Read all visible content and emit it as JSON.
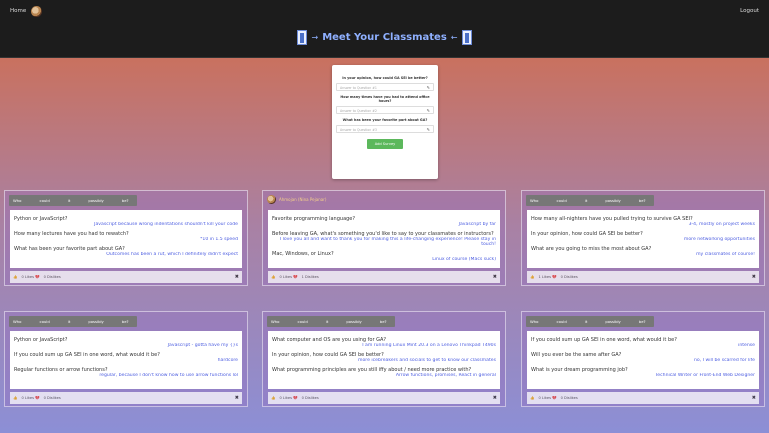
{
  "nav": {
    "home": "Home",
    "logout": "Logout"
  },
  "brand": {
    "title": "Meet Your Classmates"
  },
  "survey": {
    "q1": "In your opinion, how could GA SEI be better?",
    "q1_placeholder": "Answer to Question #1",
    "q2": "How many times have you had to attend office hours?",
    "q2_placeholder": "Answer to Question #2",
    "q3": "What has been your favorite part about GA?",
    "q3_placeholder": "Answer to Question #3",
    "submit": "Add Survey"
  },
  "tabs": [
    "Who",
    "could",
    "it",
    "possibly",
    "be?"
  ],
  "cards": [
    {
      "qa": [
        {
          "q": "Python or JavaScript?",
          "a": "Javascript because wrong indentations shouldn't kill your code"
        },
        {
          "q": "How many lectures have you had to rewatch?",
          "a": "*10 in 1.5 speed"
        },
        {
          "q": "What has been your favorite part about GA?",
          "a": "Outcomes has been a rut, which I definitely didn't expect"
        }
      ],
      "likes": "0 Likes",
      "dislikes": "0 Dislikes"
    },
    {
      "user": "Ahmojan (Nina Pejanar)",
      "qa": [
        {
          "q": "Favorite programming language?",
          "a": "Javascript by far"
        },
        {
          "q": "Before leaving GA, what's something you'd like to say to your classmates or instructors?",
          "a": "I love you all and want to thank you for making this a life-changing experience! Please stay in touch!"
        },
        {
          "q": "Mac, Windows, or Linux?",
          "a": "Linux of course (Macs suck)"
        }
      ],
      "likes": "0 Likes",
      "dislikes": "1 Dislikes"
    },
    {
      "qa": [
        {
          "q": "How many all-nighters have you pulled trying to survive GA SEI?",
          "a": "3-4, mostly on project weeks"
        },
        {
          "q": "In your opinion, how could GA SEI be better?",
          "a": "more networking opportunities"
        },
        {
          "q": "What are you going to miss the most about GA?",
          "a": "my classmates of course!"
        }
      ],
      "likes": "1 Likes",
      "dislikes": "0 Dislikes"
    },
    {
      "qa": [
        {
          "q": "Python or JavaScript?",
          "a": "Javascript - gotta have my {}s"
        },
        {
          "q": "If you could sum up GA SEI in one word, what would it be?",
          "a": "hardcore"
        },
        {
          "q": "Regular functions or arrow functions?",
          "a": "regular, because I don't know how to use arrow functions lol"
        }
      ],
      "likes": "0 Likes",
      "dislikes": "0 Dislikes"
    },
    {
      "qa": [
        {
          "q": "What computer and OS are you using for GA?",
          "a": "I am running Linux Mint 20.3 on a Lenovo Thinkpad T490s"
        },
        {
          "q": "In your opinion, how could GA SEI be better?",
          "a": "more icebreakers and socials to get to know our classmates"
        },
        {
          "q": "What programming principles are you still iffy about / need more practice with?",
          "a": "Arrow functions, promises, React in general"
        }
      ],
      "likes": "0 Likes",
      "dislikes": "0 Dislikes"
    },
    {
      "qa": [
        {
          "q": "If you could sum up GA SEI in one word, what would it be?",
          "a": "intense"
        },
        {
          "q": "Will you ever be the same after GA?",
          "a": "no, I will be scarred for life"
        },
        {
          "q": "What is your dream programming job?",
          "a": "Technical Writer or Front-End Web Designer"
        }
      ],
      "likes": "0 Likes",
      "dislikes": "0 Dislikes"
    }
  ]
}
